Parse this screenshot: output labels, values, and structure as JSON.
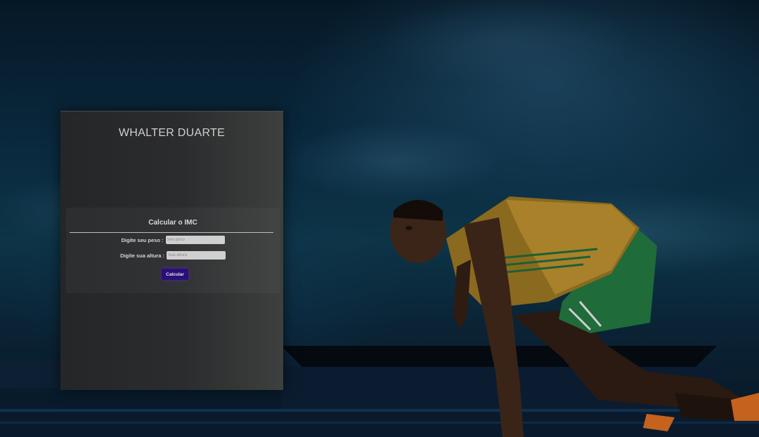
{
  "brand": {
    "title": "WHALTER DUARTE"
  },
  "imc_form": {
    "title": "Calcular o IMC",
    "weight_label": "Digite seu peso :",
    "weight_placeholder": "Seu peso",
    "height_label": "Digite sua altura :",
    "height_placeholder": "Sua altura",
    "submit_label": "Calcular"
  },
  "colors": {
    "button": "#2a0f7a",
    "card": "#2b2c2e"
  }
}
